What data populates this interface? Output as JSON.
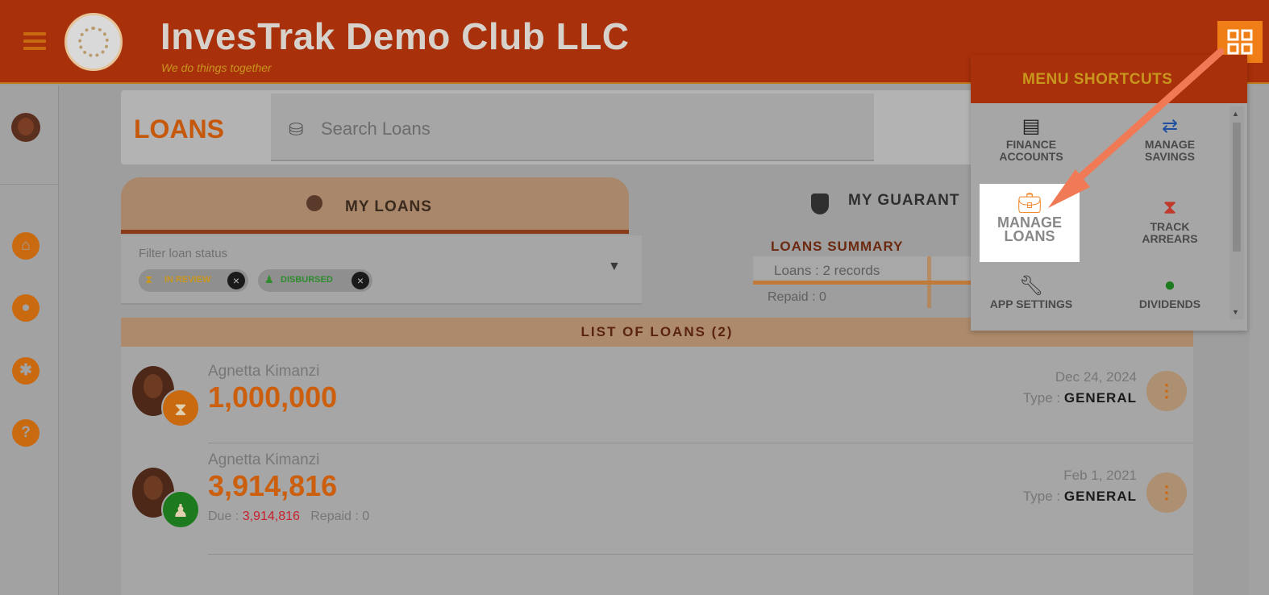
{
  "header": {
    "title": "InvesTrak Demo Club LLC",
    "subtitle": "We do things together"
  },
  "toolbar": {
    "page_title": "LOANS",
    "search_placeholder": "Search Loans"
  },
  "tabs": [
    {
      "label": "MY LOANS",
      "active": true
    },
    {
      "label": "MY GUARANT",
      "active": false
    }
  ],
  "filter": {
    "label": "Filter loan status",
    "chips": [
      {
        "label": "IN REVIEW",
        "color": "#c9961e"
      },
      {
        "label": "DISBURSED",
        "color": "#2e8b2e"
      }
    ]
  },
  "summary": {
    "title": "LOANS SUMMARY",
    "loans": "Loans : 2 records",
    "repaid": "Repaid : 0"
  },
  "list": {
    "header": "LIST OF LOANS (2)",
    "rows": [
      {
        "borrower": "Agnetta Kimanzi",
        "amount": "1,000,000",
        "date": "Dec 24, 2024",
        "type_label": "Type :",
        "type": "GENERAL",
        "status_icon": "hourglass-icon",
        "status_color": "#c96a10"
      },
      {
        "borrower": "Agnetta Kimanzi",
        "amount": "3,914,816",
        "due_label": "Due :",
        "due": "3,914,816",
        "repaid_label": "Repaid : 0",
        "date": "Feb 1, 2021",
        "type_label": "Type :",
        "type": "GENERAL",
        "status_icon": "user-icon",
        "status_color": "#1e7a1e"
      }
    ]
  },
  "shortcuts": {
    "title": "MENU SHORTCUTS",
    "items": [
      {
        "label1": "FINANCE",
        "label2": "ACCOUNTS",
        "icon": "finance-icon"
      },
      {
        "label1": "MANAGE",
        "label2": "SAVINGS",
        "icon": "savings-icon"
      },
      {
        "label1": "MANAGE",
        "label2": "LOANS",
        "icon": "loans-icon"
      },
      {
        "label1": "TRACK",
        "label2": "ARREARS",
        "icon": "hourglass-icon"
      },
      {
        "label1": "APP SETTINGS",
        "label2": "",
        "icon": "wrench-icon"
      },
      {
        "label1": "DIVIDENDS",
        "label2": "",
        "icon": "money-bag-icon"
      }
    ]
  },
  "colors": {
    "header_bg": "#a8300a",
    "accent": "#f07e16",
    "amount": "#cc5f0e"
  }
}
